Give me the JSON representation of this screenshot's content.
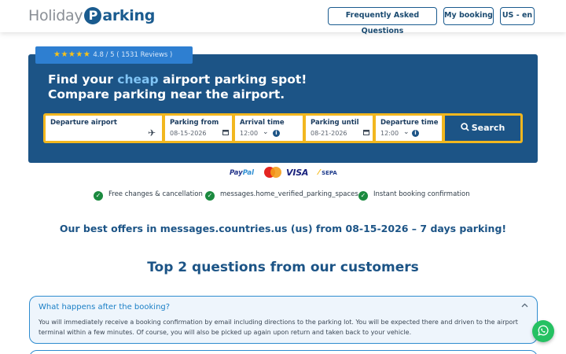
{
  "header": {
    "logo_part1": "Holiday",
    "logo_p": "P",
    "logo_part2": "arking",
    "faq_label": "Frequently Asked Questions",
    "mybooking_label": "My booking",
    "lang_label": "US - en"
  },
  "hero": {
    "rating_stars": "★★★★★",
    "rating_text": "4.8 / 5 ( 1531 Reviews )",
    "title_prefix": "Find your",
    "title_highlight": "cheap",
    "title_suffix": "airport parking spot!",
    "title_line2": "Compare parking near the airport."
  },
  "form": {
    "departure_airport_label": "Departure airport",
    "departure_airport_value": "",
    "parking_from_label": "Parking from",
    "parking_from_value": "08-15-2026",
    "arrival_time_label": "Arrival time",
    "arrival_time_value": "12:00",
    "parking_until_label": "Parking until",
    "parking_until_value": "08-21-2026",
    "departure_time_label": "Departure time",
    "departure_time_value": "12:00",
    "search_label": "Search"
  },
  "payments": {
    "paypal_1": "Pay",
    "paypal_2": "Pal",
    "visa": "VISA",
    "sepa": "SEPA"
  },
  "features": [
    "Free changes & cancellation",
    "messages.home_verified_parking_spaces",
    "Instant booking confirmation"
  ],
  "offers_heading": "Our best offers in messages.countries.us (us) from 08-15-2026 – 7 days parking!",
  "questions_heading": "Top 2 questions from our customers",
  "faq": [
    {
      "question": "What happens after the booking?",
      "answer": "You will immediately receive a booking confirmation by email including directions to the parking lot. You will be expected there and driven to the airport terminal within a few minutes. Of course, you will also be picked up again upon return and taken back to your vehicle."
    }
  ],
  "colors": {
    "brand": "#1c5486",
    "accent": "#f2b71f",
    "success": "#1b8a3f",
    "whatsapp": "#25c162"
  },
  "icons": {
    "plane": "airplane-icon",
    "calendar": "calendar-icon",
    "chevron": "chevron-down-icon",
    "info": "info-icon",
    "search": "search-icon",
    "check": "check-circle-icon",
    "whatsapp": "whatsapp-icon"
  }
}
